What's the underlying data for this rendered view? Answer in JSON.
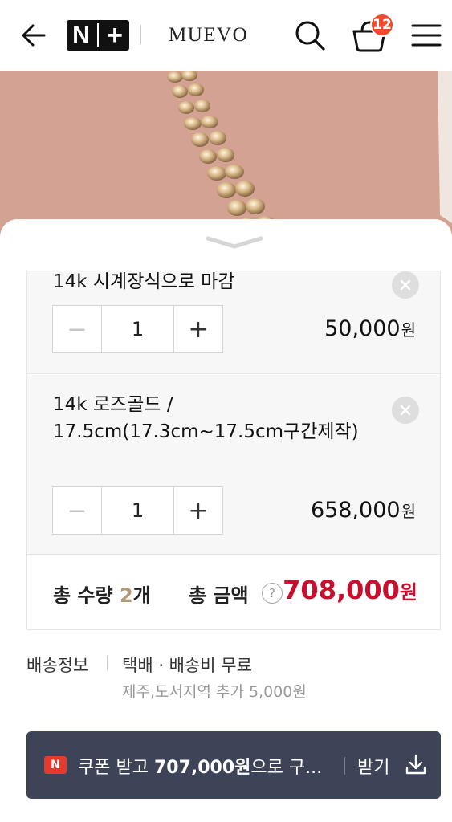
{
  "header": {
    "logo_left": "N",
    "logo_right": "+",
    "brand": "MUEVO",
    "cart_count": "12"
  },
  "options": [
    {
      "name": "14k 시계장식으로 마감",
      "quantity": "1",
      "price": "50,000",
      "currency": "원"
    },
    {
      "name": "14k 로즈골드 / 17.5cm(17.3cm~17.5cm구간제작)",
      "quantity": "1",
      "price": "658,000",
      "currency": "원"
    }
  ],
  "total": {
    "qty_label_prefix": "총 수량 ",
    "qty_value": "2",
    "qty_unit": "개",
    "amount_label": "총 금액",
    "help_symbol": "?",
    "amount_value": "708,000",
    "currency": "원"
  },
  "shipping": {
    "label": "배송정보",
    "value": "택배 · 배송비 무료",
    "extra": "제주,도서지역 추가 5,000원"
  },
  "coupon": {
    "badge": "N",
    "text_prefix": "쿠폰 받고 ",
    "text_amount": "707,000원",
    "text_suffix": "으로 구...",
    "receive_label": "받기"
  },
  "icons": {
    "back": "arrow-left-icon",
    "search": "search-icon",
    "cart": "shopping-bag-icon",
    "menu": "hamburger-menu-icon",
    "collapse": "chevron-down-icon",
    "remove": "close-circle-icon",
    "download": "download-icon"
  },
  "colors": {
    "total_price": "#c8102e",
    "badge": "#f04a2c",
    "coupon_bg": "#3d4457",
    "qty_accent": "#b39a77"
  }
}
